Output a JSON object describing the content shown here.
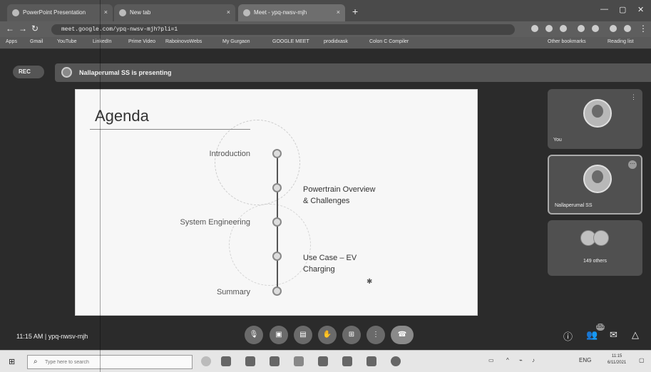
{
  "browser": {
    "tabs": [
      {
        "label": "PowerPoint Presentation"
      },
      {
        "label": "New tab"
      },
      {
        "label": "Meet - ypq-nwsv-mjh"
      }
    ],
    "url": "meet.google.com/ypq-nwsv-mjh?pli=1",
    "bookmarks": [
      "Apps",
      "Gmail",
      "YouTube",
      "LinkedIn",
      "Prime Video",
      "RaboinovoWebs",
      "My Gurgaon",
      "GOOGLE MEET",
      "prodidxask",
      "Colon C Compiler",
      "Other bookmarks",
      "Reading list"
    ]
  },
  "meet": {
    "rec_label": "REC",
    "presenting_text": "Nallaperumal SS is presenting",
    "meeting_time": "11:15 AM",
    "meeting_code": "ypq-nwsv-mjh",
    "participants": [
      {
        "name": "You"
      },
      {
        "name": "Nallaperumal SS"
      },
      {
        "name": "149 others"
      }
    ],
    "people_count": "152"
  },
  "slide": {
    "title": "Agenda",
    "items_left": [
      "Introduction",
      "System Engineering",
      "Summary"
    ],
    "items_right": [
      {
        "line1": "Powertrain Overview",
        "line2": "& Challenges"
      },
      {
        "line1": "Use Case – EV",
        "line2": "Charging"
      }
    ]
  },
  "taskbar": {
    "search_placeholder": "Type here to search",
    "time": "11:15",
    "date": "6/11/2021",
    "lang": "ENG"
  }
}
